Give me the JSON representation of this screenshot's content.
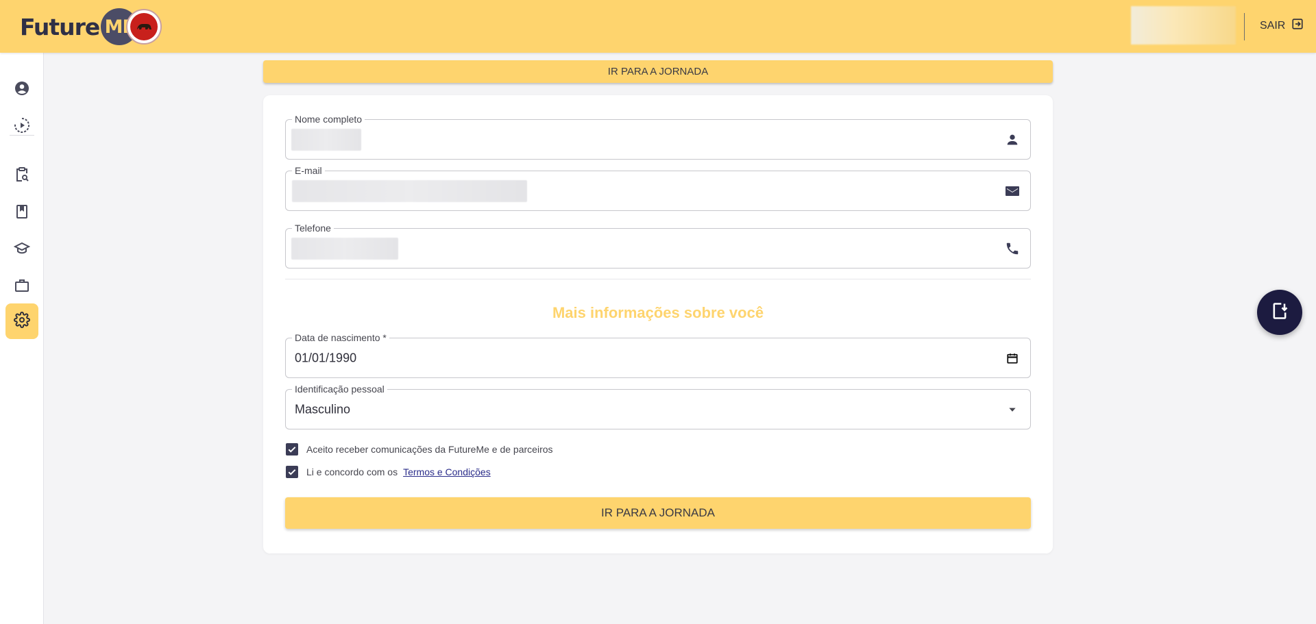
{
  "brand": {
    "logo_text": "Future",
    "logo_me": "ME",
    "seal_name": "partner-seal"
  },
  "header": {
    "logout_label": "SAIR"
  },
  "sidebar": {
    "items": [
      {
        "icon": "user-circle-icon",
        "active": false
      },
      {
        "icon": "play-circle-icon",
        "active": false
      },
      {
        "icon": "clipboard-search-icon",
        "active": false
      },
      {
        "icon": "bookmark-book-icon",
        "active": false
      },
      {
        "icon": "graduation-cap-icon",
        "active": false
      },
      {
        "icon": "briefcase-icon",
        "active": false
      },
      {
        "icon": "gear-icon",
        "active": true
      }
    ]
  },
  "top_cta": {
    "label": "IR PARA A JORNADA"
  },
  "form": {
    "name": {
      "label": "Nome completo",
      "value": ""
    },
    "email": {
      "label": "E-mail",
      "value": ""
    },
    "phone": {
      "label": "Telefone",
      "value": ""
    },
    "section_title": "Mais informações sobre você",
    "birthdate": {
      "label": "Data de nascimento *",
      "value": "01/01/1990"
    },
    "identity": {
      "label": "Identificação pessoal",
      "value": "Masculino"
    },
    "consent_communications": {
      "label": "Aceito receber comunicações da FutureMe e de parceiros",
      "checked": true
    },
    "consent_terms": {
      "label": "Li e concordo com os",
      "link": "Termos e Condições",
      "checked": true
    },
    "submit_label": "IR PARA A JORNADA"
  },
  "colors": {
    "accent": "#fed46e",
    "dark": "#3b3c56",
    "fab": "#1c1b40"
  }
}
